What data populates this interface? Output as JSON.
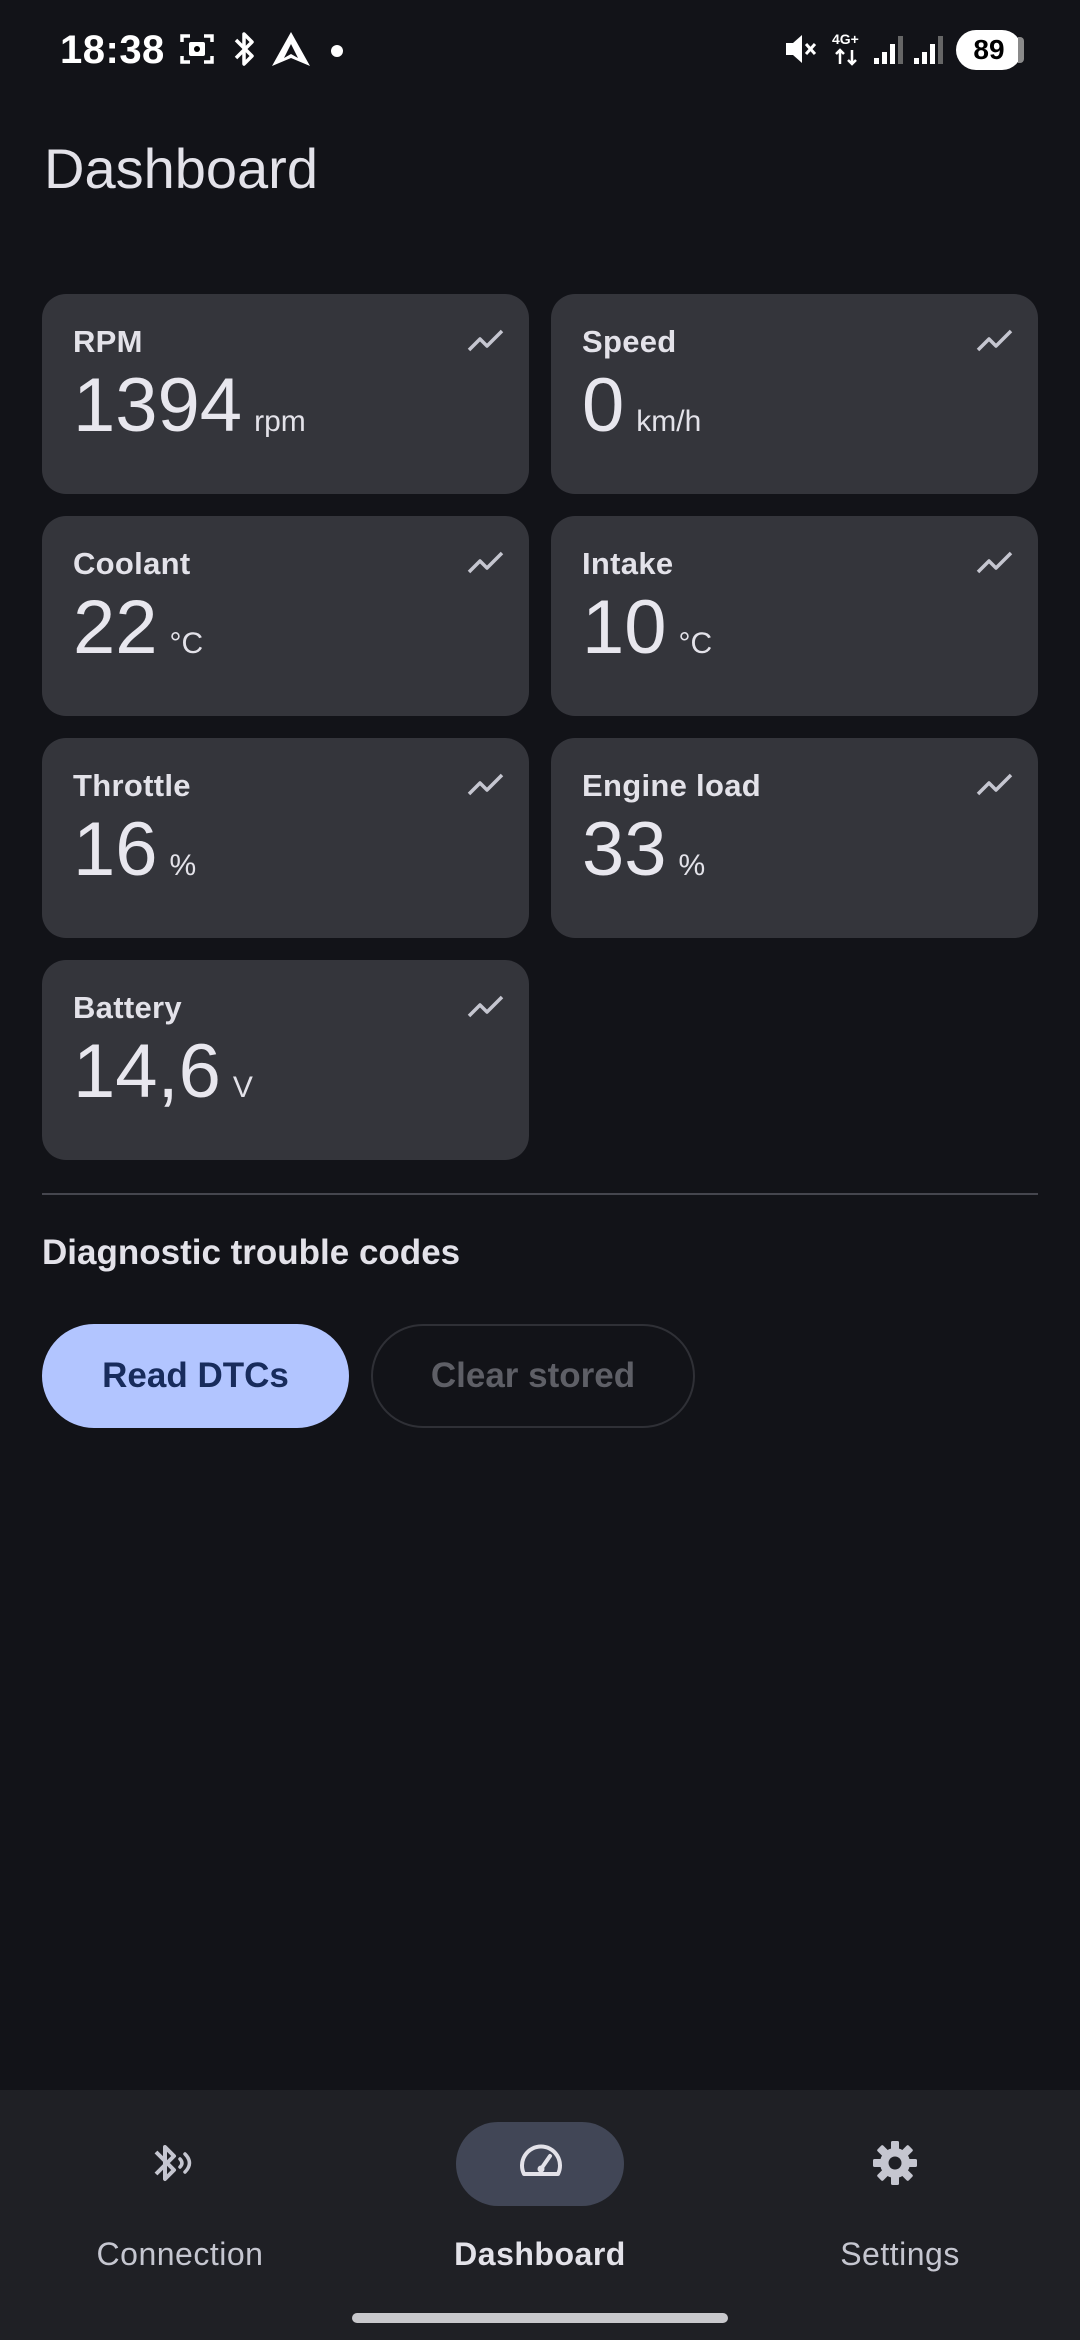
{
  "status_bar": {
    "time": "18:38",
    "battery": "89",
    "icons": [
      "screenshot-icon",
      "bluetooth-icon",
      "android-auto-icon",
      "dot-icon",
      "mute-icon",
      "4g-icon",
      "signal-icon",
      "signal-icon"
    ]
  },
  "page": {
    "title": "Dashboard"
  },
  "metrics": [
    {
      "label": "RPM",
      "value": "1394",
      "unit": "rpm"
    },
    {
      "label": "Speed",
      "value": "0",
      "unit": "km/h"
    },
    {
      "label": "Coolant",
      "value": "22",
      "unit": "°C"
    },
    {
      "label": "Intake",
      "value": "10",
      "unit": "°C"
    },
    {
      "label": "Throttle",
      "value": "16",
      "unit": "%"
    },
    {
      "label": "Engine load",
      "value": "33",
      "unit": "%"
    },
    {
      "label": "Battery",
      "value": "14,6",
      "unit": "V"
    }
  ],
  "dtc": {
    "title": "Diagnostic trouble codes",
    "read_label": "Read DTCs",
    "clear_label": "Clear stored"
  },
  "nav": [
    {
      "label": "Connection",
      "icon": "bluetooth-searching-icon",
      "active": false
    },
    {
      "label": "Dashboard",
      "icon": "speedometer-icon",
      "active": true
    },
    {
      "label": "Settings",
      "icon": "gear-icon",
      "active": false
    }
  ],
  "colors": {
    "background": "#121318",
    "card": "#34353b",
    "primary_button": "#b2c5ff",
    "nav_active_pill": "#414656"
  }
}
